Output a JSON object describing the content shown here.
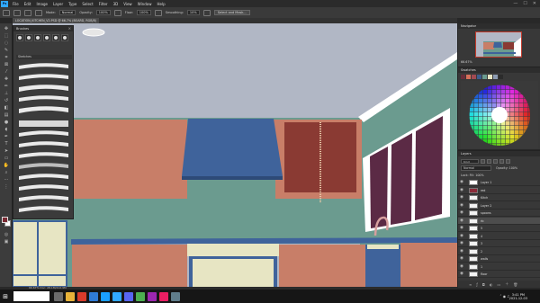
{
  "app": {
    "logo": "Ps",
    "menu": [
      "File",
      "Edit",
      "Image",
      "Layer",
      "Type",
      "Select",
      "Filter",
      "3D",
      "View",
      "Window",
      "Help"
    ],
    "window_controls": [
      "—",
      "☐",
      "✕"
    ]
  },
  "options": {
    "mode_label": "Mode:",
    "mode_value": "Normal",
    "opacity_label": "Opacity:",
    "opacity_value": "100%",
    "flow_label": "Flow:",
    "flow_value": "100%",
    "smoothing_label": "Smoothing:",
    "smoothing_value": "10%",
    "select_mask_button": "Select and Mask..."
  },
  "document": {
    "tab_title": "LOCATION_KITCHEN_V2.PSD @ 66.7% (BOARD, RGB/8)"
  },
  "brushes_panel": {
    "title": "Brushes",
    "folder_name": "Sketches"
  },
  "navigator": {
    "tab_label": "Navigator",
    "zoom": "66.67%"
  },
  "swatches": {
    "title": "Swatches",
    "recent": [
      "#6b2e3a",
      "#d8705a",
      "#a14a52",
      "#3d5d8d",
      "#6a9a8e",
      "#e7e5c3",
      "#8c9bb2",
      "#2b2b2b"
    ]
  },
  "layers": {
    "title": "Layers",
    "kind_label": "Kind",
    "blend_mode": "Normal",
    "opacity_label": "Opacity: 100%",
    "lock_label": "Lock:   Fill: 100%",
    "rows": [
      {
        "name": "Layer 1",
        "selected": false,
        "thumb": "#ffffff"
      },
      {
        "name": "red",
        "selected": false,
        "thumb": "#8a2a38"
      },
      {
        "name": "Kitch",
        "selected": false,
        "thumb": "#f2f2f2"
      },
      {
        "name": "Layer 2",
        "selected": false,
        "thumb": "#f2f2f2"
      },
      {
        "name": "spoons",
        "selected": false,
        "thumb": "#f2f2f2"
      },
      {
        "name": "rb",
        "selected": true,
        "thumb": "#f2f2f2"
      },
      {
        "name": "5",
        "selected": false,
        "thumb": "#f2f2f2"
      },
      {
        "name": "4",
        "selected": false,
        "thumb": "#f2f2f2"
      },
      {
        "name": "3",
        "selected": false,
        "thumb": "#f2f2f2"
      },
      {
        "name": "2",
        "selected": false,
        "thumb": "#f2f2f2"
      },
      {
        "name": "walls",
        "selected": false,
        "thumb": "#f2f2f2"
      },
      {
        "name": "1",
        "selected": false,
        "thumb": "#f2f2f2"
      },
      {
        "name": "floor",
        "selected": false,
        "thumb": "#f2f2f2"
      }
    ]
  },
  "status": {
    "text": "66.67%     Doc: 28.1M/412.9M"
  },
  "taskbar": {
    "time": "3:41 PM",
    "date": "2021-12-03"
  }
}
